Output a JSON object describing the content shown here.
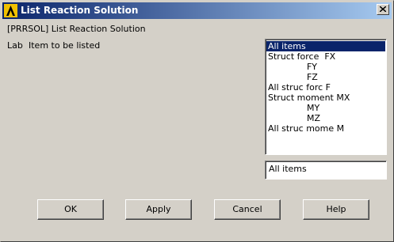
{
  "window": {
    "title": "List Reaction Solution"
  },
  "form": {
    "command_label": "[PRRSOL]  List Reaction Solution",
    "lab_label": "Lab",
    "lab_description": "Item to be listed"
  },
  "listbox": {
    "items": [
      "All items",
      "Struct force  FX",
      "              FY",
      "              FZ",
      "All struc forc F",
      "Struct moment MX",
      "              MY",
      "              MZ",
      "All struc mome M"
    ],
    "selected_index": 0
  },
  "selection_field": {
    "value": "All items"
  },
  "buttons": {
    "ok": "OK",
    "apply": "Apply",
    "cancel": "Cancel",
    "help": "Help"
  },
  "colors": {
    "title_start": "#0a246a",
    "title_end": "#a6caf0",
    "selection": "#0a246a",
    "dialog_bg": "#d4d0c8"
  }
}
